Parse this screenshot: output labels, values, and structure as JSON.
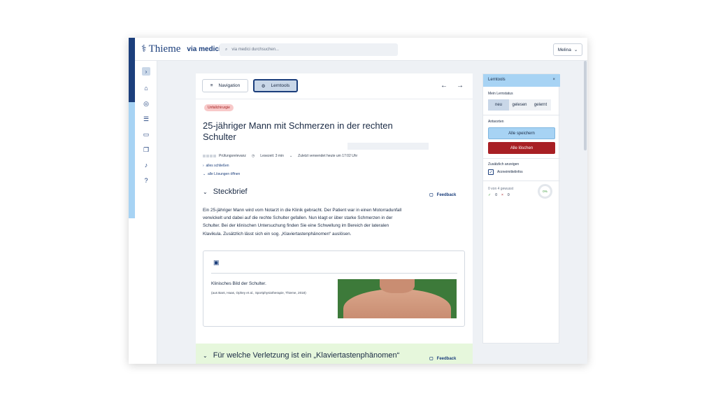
{
  "app": {
    "logo": "Thieme",
    "logo_sub": "via medici",
    "search_placeholder": "via medici durchsuchen...",
    "user": "Melina"
  },
  "toolbar": {
    "navigation": "Navigation",
    "lerntools": "Lerntools"
  },
  "article": {
    "tag": "Unfallchirurgie",
    "title": "25-jähriger Mann mit Schmerzen in der rechten Schulter",
    "relevance": "Prüfungsrelevanz",
    "read_time": "Lesezeit: 3 min",
    "last_used": "Zuletzt verwendet heute um 17:02 Uhr",
    "close_all": "alles schließen",
    "open_solutions": "alle Lösungen öffnen",
    "section1": "Steckbrief",
    "feedback": "Feedback",
    "paragraph": "Ein 25-jähriger Mann wird vom Notarzt in die Klinik gebracht. Der Patient war in einen Motorradunfall verwickelt und dabei auf die rechte Schulter gefallen. Nun klagt er über starke Schmerzen in der Schulter. Bei der klinischen Untersuchung finden Sie eine Schwellung im Bereich der lateralen Klavikula. Zusätzlich lässt sich ein sog. „Klaviertastenphänomen“ auslösen.",
    "figure_caption": "Klinisches Bild der Schulter.",
    "figure_source": "(aus Bant, Haas, Ophey et al., Sportphysiotherapie, Thieme, 2018)",
    "question": "Für welche Verletzung ist ein „Klaviertastenphänomen“"
  },
  "panel": {
    "title": "Lerntools",
    "status_label": "Mein Lernstatus",
    "status_options": [
      "neu",
      "gelesen",
      "gelernt"
    ],
    "answers_label": "Antworten",
    "save_all": "Alle speichern",
    "delete_all": "Alle löschen",
    "extra_label": "Zusätzlich anzeigen",
    "drug_info": "Arzneimittelinfos",
    "progress_text": "0 von 4 gewusst",
    "correct": "0",
    "wrong": "0",
    "percent": "0%"
  }
}
